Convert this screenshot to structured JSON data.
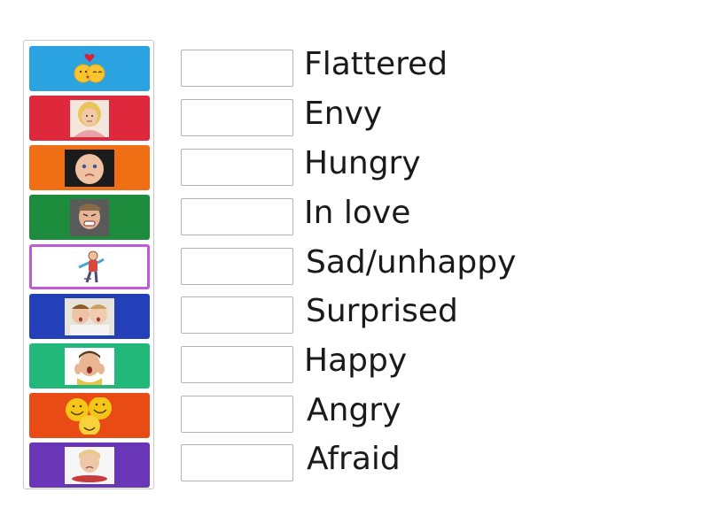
{
  "tiles": [
    {
      "icon": "kissing-emoji-icon",
      "color": "#2ba3e0"
    },
    {
      "icon": "envy-girl-photo-icon",
      "color": "#e0283c"
    },
    {
      "icon": "hungry-baby-photo-icon",
      "color": "#f06e14"
    },
    {
      "icon": "angry-boy-photo-icon",
      "color": "#1d8c3c"
    },
    {
      "icon": "afraid-cartoon-man-icon",
      "color": "#ffffff",
      "outline": "#c15ad4"
    },
    {
      "icon": "surprised-kids-photo-icon",
      "color": "#2340b8"
    },
    {
      "icon": "flattered-boy-photo-icon",
      "color": "#22b87a"
    },
    {
      "icon": "happy-smileys-icon",
      "color": "#e84c14"
    },
    {
      "icon": "sad-girl-photo-icon",
      "color": "#6a36b8"
    }
  ],
  "labels": [
    "Flattered",
    "Envy",
    "Hungry",
    "In love",
    "Sad/unhappy",
    "Surprised",
    "Happy",
    "Angry",
    "Afraid"
  ]
}
